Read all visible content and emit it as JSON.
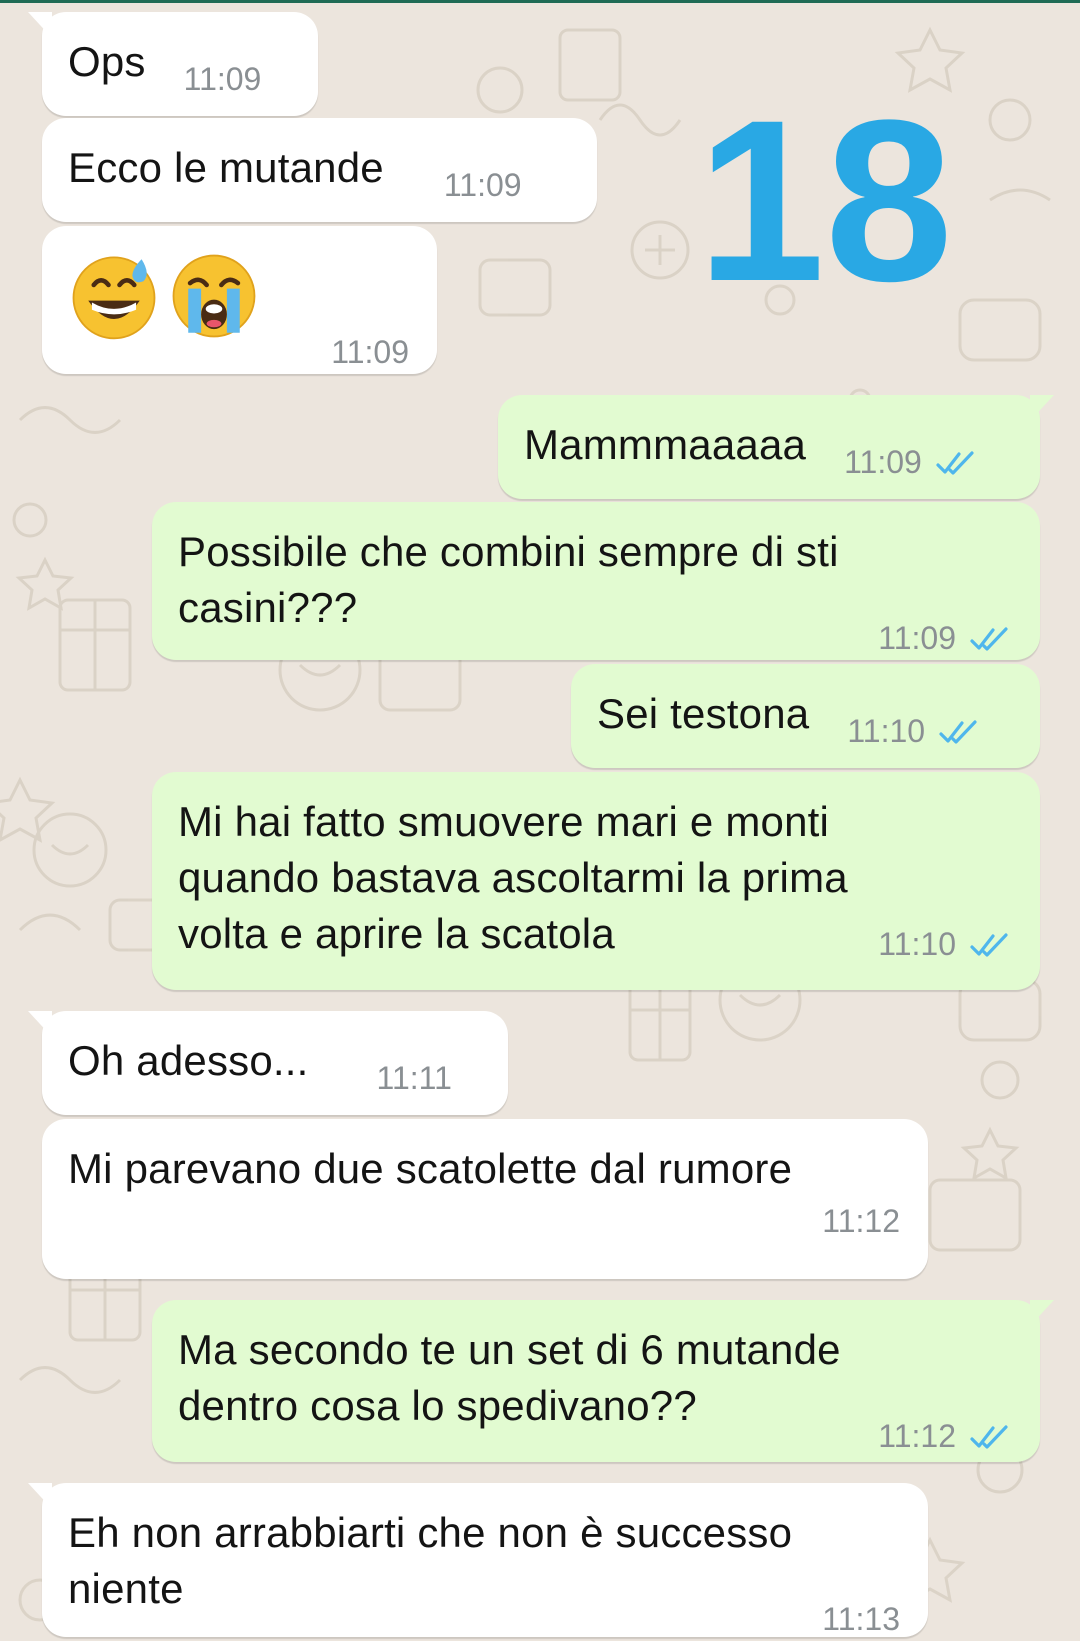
{
  "colors": {
    "background": "#ece5dd",
    "incoming_bubble": "#ffffff",
    "outgoing_bubble": "#e2fbd1",
    "timestamp": "#8a8f93",
    "read_ticks": "#4fb6ec",
    "overlay_number": "#29a8e4"
  },
  "overlay": {
    "text": "18"
  },
  "messages": [
    {
      "direction": "incoming",
      "text": "Ops",
      "time": "11:09"
    },
    {
      "direction": "incoming",
      "text": "Ecco le mutande",
      "time": "11:09"
    },
    {
      "direction": "incoming",
      "text": "",
      "emojis": [
        "grinning-sweat-emoji",
        "loudly-crying-emoji"
      ],
      "time": "11:09"
    },
    {
      "direction": "outgoing",
      "text": "Mammmaaaaa",
      "time": "11:09",
      "status": "read"
    },
    {
      "direction": "outgoing",
      "text": "Possibile che combini sempre di sti casini???",
      "time": "11:09",
      "status": "read"
    },
    {
      "direction": "outgoing",
      "text": "Sei testona",
      "time": "11:10",
      "status": "read"
    },
    {
      "direction": "outgoing",
      "text": "Mi hai fatto smuovere mari e monti quando bastava ascoltarmi la prima volta e aprire la scatola",
      "time": "11:10",
      "status": "read"
    },
    {
      "direction": "incoming",
      "text": "Oh adesso...",
      "time": "11:11"
    },
    {
      "direction": "incoming",
      "text": "Mi parevano due scatolette dal rumore",
      "time": "11:12"
    },
    {
      "direction": "outgoing",
      "text": "Ma secondo te un set di 6 mutande dentro cosa lo spedivano??",
      "time": "11:12",
      "status": "read"
    },
    {
      "direction": "incoming",
      "text": "Eh non arrabbiarti che non è successo niente",
      "time": "11:13"
    }
  ]
}
